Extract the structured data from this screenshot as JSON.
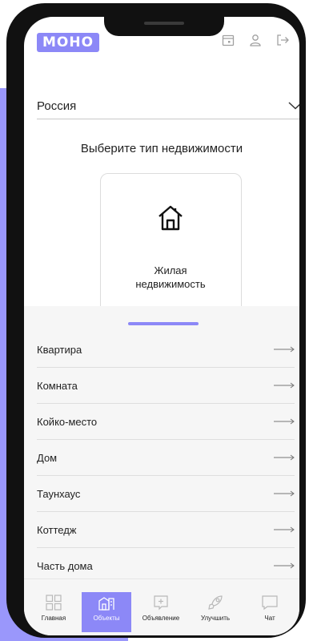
{
  "brand": {
    "logo_text": "МОНО",
    "accent": "#8c88f7"
  },
  "header": {
    "icons": [
      "calendar-icon",
      "user-icon",
      "logout-icon"
    ]
  },
  "country_select": {
    "value": "Россия"
  },
  "property_type": {
    "heading": "Выберите тип недвижимости",
    "card_label": "Жилая недвижимость"
  },
  "subtypes": [
    {
      "label": "Квартира"
    },
    {
      "label": "Комната"
    },
    {
      "label": "Койко-место"
    },
    {
      "label": "Дом"
    },
    {
      "label": "Таунхаус"
    },
    {
      "label": "Коттедж"
    },
    {
      "label": "Часть дома"
    }
  ],
  "tabs": [
    {
      "label": "Главная",
      "icon": "grid-icon",
      "active": false
    },
    {
      "label": "Объекты",
      "icon": "buildings-icon",
      "active": true
    },
    {
      "label": "Объявление",
      "icon": "add-listing-icon",
      "active": false
    },
    {
      "label": "Улучшить",
      "icon": "rocket-icon",
      "active": false
    },
    {
      "label": "Чат",
      "icon": "chat-icon",
      "active": false
    }
  ]
}
